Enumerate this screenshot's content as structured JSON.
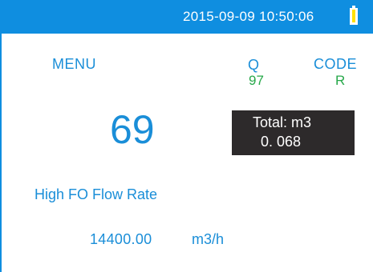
{
  "status_bar": {
    "datetime": "2015-09-09 10:50:06",
    "battery_icon": "battery-icon",
    "background_color": "#0f8ee0",
    "battery_fill_color": "#ffe100"
  },
  "header": {
    "menu_label": "MENU",
    "q_label": "Q",
    "q_value": "97",
    "code_label": "CODE",
    "code_value": "R"
  },
  "menu": {
    "number": "69",
    "title": "High FO Flow Rate"
  },
  "total": {
    "label": "Total: m3",
    "value": "0. 068"
  },
  "flow_rate": {
    "value": "14400.00",
    "unit": "m3/h"
  },
  "colors": {
    "text_blue": "#1a8ed8",
    "text_green": "#27a84a",
    "total_box": "#2d2a2b"
  }
}
